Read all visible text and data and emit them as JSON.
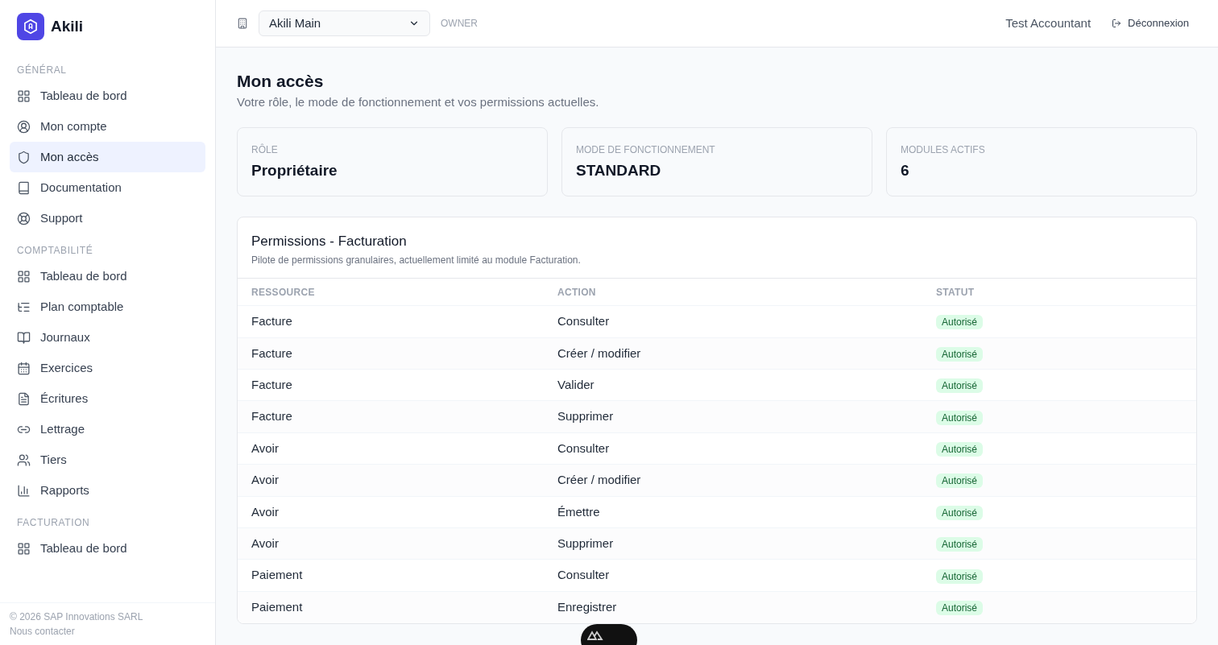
{
  "brand": {
    "name": "Akili"
  },
  "sidebar": {
    "sections": [
      {
        "title": "GÉNÉRAL",
        "items": [
          {
            "label": "Tableau de bord",
            "kind": "grid",
            "selected": false
          },
          {
            "label": "Mon compte",
            "kind": "user",
            "selected": false
          },
          {
            "label": "Mon accès",
            "kind": "shield",
            "selected": true
          },
          {
            "label": "Documentation",
            "kind": "book",
            "selected": false
          },
          {
            "label": "Support",
            "kind": "lifebuoy",
            "selected": false
          }
        ]
      },
      {
        "title": "COMPTABILITÉ",
        "items": [
          {
            "label": "Tableau de bord",
            "kind": "grid",
            "selected": false
          },
          {
            "label": "Plan comptable",
            "kind": "list",
            "selected": false
          },
          {
            "label": "Journaux",
            "kind": "reader",
            "selected": false
          },
          {
            "label": "Exercices",
            "kind": "calendar",
            "selected": false
          },
          {
            "label": "Écritures",
            "kind": "file",
            "selected": false
          },
          {
            "label": "Lettrage",
            "kind": "link",
            "selected": false
          },
          {
            "label": "Tiers",
            "kind": "users",
            "selected": false
          },
          {
            "label": "Rapports",
            "kind": "chart",
            "selected": false
          }
        ]
      },
      {
        "title": "FACTURATION",
        "items": [
          {
            "label": "Tableau de bord",
            "kind": "grid",
            "selected": false
          }
        ]
      }
    ],
    "footer": {
      "copyright": "© 2026 SAP Innovations SARL",
      "contact": "Nous contacter"
    }
  },
  "topbar": {
    "company_select": {
      "value": "Akili Main"
    },
    "role_badge": "OWNER",
    "user": "Test Accountant",
    "logout": "Déconnexion"
  },
  "page": {
    "title": "Mon accès",
    "subtitle": "Votre rôle, le mode de fonctionnement et vos permissions actuelles."
  },
  "stats": [
    {
      "label": "RÔLE",
      "value": "Propriétaire"
    },
    {
      "label": "MODE DE FONCTIONNEMENT",
      "value": "STANDARD"
    },
    {
      "label": "MODULES ACTIFS",
      "value": "6"
    }
  ],
  "permissions": {
    "title": "Permissions - Facturation",
    "subtitle": "Pilote de permissions granulaires, actuellement limité au module Facturation.",
    "columns": [
      "RESSOURCE",
      "ACTION",
      "STATUT"
    ],
    "rows": [
      {
        "resource": "Facture",
        "action": "Consulter",
        "status": "Autorisé",
        "allowed": true
      },
      {
        "resource": "Facture",
        "action": "Créer / modifier",
        "status": "Autorisé",
        "allowed": true
      },
      {
        "resource": "Facture",
        "action": "Valider",
        "status": "Autorisé",
        "allowed": true
      },
      {
        "resource": "Facture",
        "action": "Supprimer",
        "status": "Autorisé",
        "allowed": true
      },
      {
        "resource": "Avoir",
        "action": "Consulter",
        "status": "Autorisé",
        "allowed": true
      },
      {
        "resource": "Avoir",
        "action": "Créer / modifier",
        "status": "Autorisé",
        "allowed": true
      },
      {
        "resource": "Avoir",
        "action": "Émettre",
        "status": "Autorisé",
        "allowed": true
      },
      {
        "resource": "Avoir",
        "action": "Supprimer",
        "status": "Autorisé",
        "allowed": true
      },
      {
        "resource": "Paiement",
        "action": "Consulter",
        "status": "Autorisé",
        "allowed": true
      },
      {
        "resource": "Paiement",
        "action": "Enregistrer",
        "status": "Autorisé",
        "allowed": true
      }
    ]
  }
}
